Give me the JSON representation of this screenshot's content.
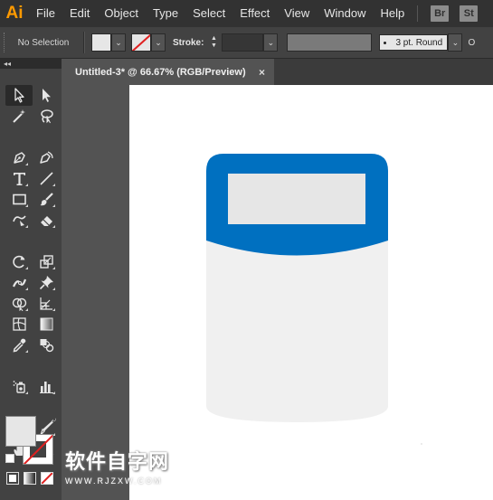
{
  "app": {
    "logo": "Ai",
    "logo_color": "#ff9a00"
  },
  "menu": {
    "items": [
      "File",
      "Edit",
      "Object",
      "Type",
      "Select",
      "Effect",
      "View",
      "Window",
      "Help"
    ],
    "app_buttons": [
      "Br",
      "St"
    ]
  },
  "control_bar": {
    "selection_status": "No Selection",
    "stroke_label": "Stroke:",
    "brush_label": "3 pt. Round",
    "trailing_label": "O"
  },
  "document": {
    "tab_title": "Untitled-3* @ 66.67% (RGB/Preview)",
    "close_glyph": "×"
  },
  "toolbar": {
    "collapse_glyph": "◂◂",
    "tools": [
      "selection-tool",
      "direct-selection-tool",
      "magic-wand-tool",
      "lasso-tool",
      "pen-tool",
      "curvature-tool",
      "type-tool",
      "line-tool",
      "rectangle-tool",
      "paintbrush-tool",
      "shaper-tool",
      "eraser-tool",
      "rotate-tool",
      "scale-tool",
      "width-tool",
      "puppet-warp-tool",
      "shape-builder-tool",
      "perspective-grid-tool",
      "mesh-tool",
      "gradient-tool",
      "eyedropper-tool",
      "blend-tool",
      "symbol-sprayer-tool",
      "column-graph-tool",
      "artboard-tool",
      "slice-tool",
      "hand-tool",
      "zoom-tool"
    ],
    "fill_color": "#e6e6e6",
    "stroke_none_color": "#e02020"
  },
  "artwork": {
    "cap_color": "#0070c0",
    "label_color": "#e6e6e6",
    "body_color": "#f0f0f0"
  },
  "watermark": {
    "chinese_text": "软件自字网",
    "url_text": "WWW.RJZXW.COM"
  }
}
